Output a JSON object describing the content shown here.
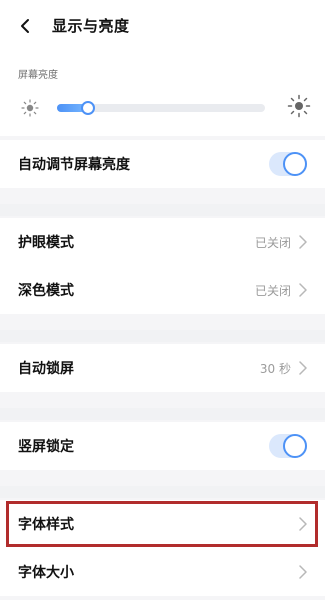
{
  "header": {
    "title": "显示与亮度"
  },
  "brightness": {
    "section_label": "屏幕亮度",
    "level": 0.15
  },
  "rows": [
    {
      "label": "自动调节屏幕亮度",
      "type": "toggle",
      "state": true
    },
    {
      "label": "护眼模式",
      "value": "已关闭"
    },
    {
      "label": "深色模式",
      "value": "已关闭"
    },
    {
      "label": "自动锁屏",
      "value": "30 秒"
    },
    {
      "label": "竖屏锁定",
      "type": "toggle",
      "state": true
    },
    {
      "label": "字体样式",
      "value": ""
    },
    {
      "label": "字体大小",
      "value": ""
    }
  ],
  "colors": {
    "accent": "#4d92f6",
    "highlight": "#b12c2c"
  },
  "icons": {
    "back": "chevron-left-icon",
    "sun_small": "sun-small-icon",
    "sun_large": "sun-large-icon",
    "chevron": "chevron-right-icon"
  }
}
